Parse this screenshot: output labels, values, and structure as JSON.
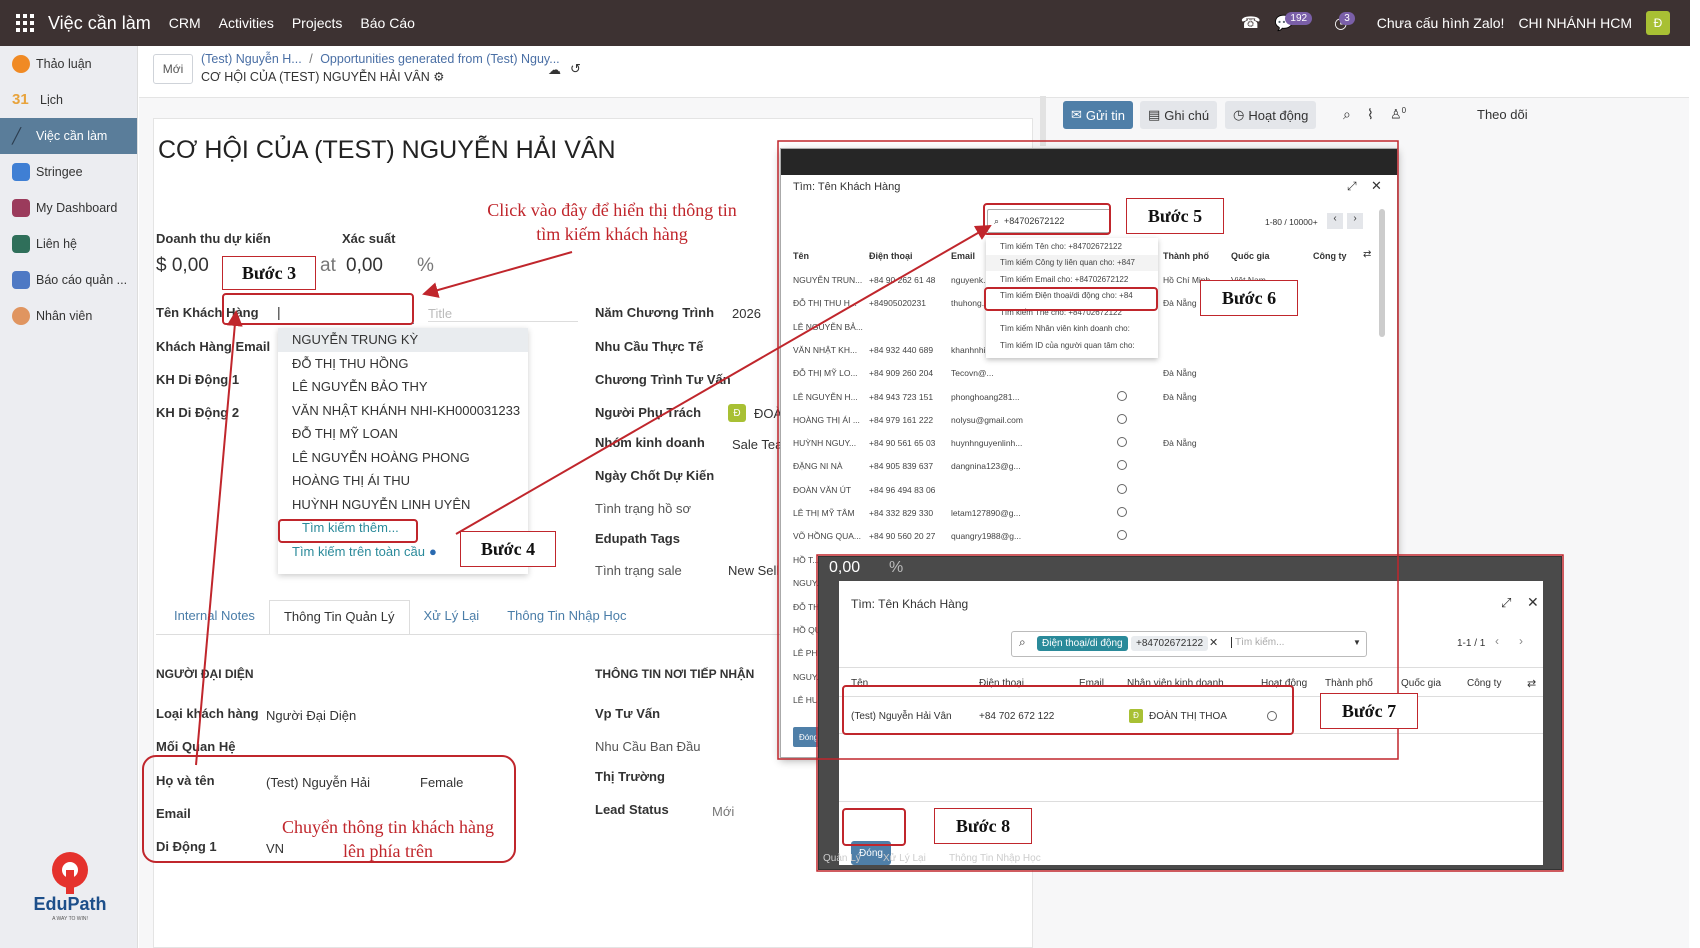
{
  "topbar": {
    "app_title": "Việc cần làm",
    "menus": [
      "CRM",
      "Activities",
      "Projects",
      "Báo Cáo"
    ],
    "badge_messages": "192",
    "badge_activities": "3",
    "zalo_status": "Chưa cấu hình Zalo!",
    "branch": "CHI NHÁNH HCM",
    "avatar_letter": "Đ"
  },
  "sidebar": {
    "items": [
      {
        "label": "Thảo luận",
        "icon": "discuss-icon"
      },
      {
        "label": "Lịch",
        "icon": "calendar-icon"
      },
      {
        "label": "Việc cần làm",
        "icon": "todo-icon"
      },
      {
        "label": "Stringee",
        "icon": "stringee-icon"
      },
      {
        "label": "My Dashboard",
        "icon": "dashboard-icon"
      },
      {
        "label": "Liên hệ",
        "icon": "contacts-icon"
      },
      {
        "label": "Báo cáo quản ...",
        "icon": "report-icon"
      },
      {
        "label": "Nhân viên",
        "icon": "employees-icon"
      }
    ],
    "logo_text": "EduPath",
    "logo_tagline": "A WAY TO WIN!"
  },
  "control": {
    "new_button": "Mới",
    "breadcrumb_1": "(Test) Nguyễn H...",
    "breadcrumb_sep": "/",
    "breadcrumb_2": "Opportunities generated from (Test) Nguy...",
    "record_title": "CƠ HỘI CỦA (TEST) NGUYỄN HẢI VÂN"
  },
  "form": {
    "title": "CƠ HỘI CỦA (TEST) NGUYỄN HẢI VÂN",
    "expected_revenue_label": "Doanh thu dự kiến",
    "expected_revenue": "$ 0,00",
    "probability_label": "Xác suất",
    "at_label": "at",
    "probability": "0,00",
    "percent": "%",
    "customer_name_label": "Tên Khách Hàng",
    "title_placeholder": "Title",
    "customer_email_label": "Khách Hàng Email",
    "mobile1_label": "KH Di Động 1",
    "mobile2_label": "KH Di Động 2",
    "program_year_label": "Năm Chương Trình",
    "program_year": "2026",
    "need_label": "Nhu Cầu Thực Tế",
    "program_label": "Chương Trình Tư Vấn",
    "owner_label": "Người Phụ Trách",
    "owner_value": "ĐOÀ",
    "team_label": "Nhóm kinh doanh",
    "team_value": "Sale Tea",
    "close_date_label": "Ngày Chốt Dự Kiến",
    "profile_status_label": "Tình trạng hồ sơ",
    "tags_label": "Edupath Tags",
    "sale_status_label": "Tình trạng sale",
    "sale_status_value": "New Sell",
    "tabs": [
      "Internal Notes",
      "Thông Tin Quản Lý",
      "Xử Lý Lại",
      "Thông Tin Nhập Học"
    ],
    "rep_section": "NGƯỜI ĐẠI DIỆN",
    "customer_type_label": "Loại khách hàng",
    "customer_type_value": "Người Đại Diện",
    "relation_label": "Mối Quan Hệ",
    "fullname_label": "Họ và tên",
    "fullname_value": "(Test) Nguyễn Hải",
    "gender_value": "Female",
    "email_label": "Email",
    "mobile_label": "Di Động 1",
    "mobile_prefix": "VN",
    "receive_section": "THÔNG TIN NƠI TIẾP NHẬN",
    "office_label": "Vp Tư Vấn",
    "initial_need_label": "Nhu Cầu Ban Đầu",
    "market_label": "Thị Trường",
    "lead_status_label": "Lead Status",
    "lead_status_value": "Mới"
  },
  "dropdown": {
    "items": [
      "NGUYỄN TRUNG KỲ",
      "ĐỖ THỊ THU HỒNG",
      "LÊ NGUYỄN BẢO THY",
      "VĂN NHẬT KHÁNH NHI-KH000031233",
      "ĐỖ THỊ MỸ LOAN",
      "LÊ NGUYỄN HOÀNG PHONG",
      "HOÀNG THỊ ÁI THU",
      "HUỲNH NGUYỄN LINH UYÊN"
    ],
    "search_more": "Tìm kiếm thêm...",
    "search_global": "Tìm kiếm trên toàn cầu"
  },
  "chatter": {
    "send": "Gửi tin",
    "note": "Ghi chú",
    "activity": "Hoạt động",
    "attach_count": "0",
    "follow": "Theo dõi"
  },
  "dialog1": {
    "title": "Tìm: Tên Khách Hàng",
    "search_value": "+84702672122",
    "pager": "1-80 / 10000+",
    "columns": [
      "Tên",
      "Điện thoại",
      "Email",
      "Thành phố",
      "Quốc gia",
      "Công ty"
    ],
    "rows": [
      {
        "name": "NGUYỄN TRUN...",
        "phone": "+84 90 262 61 48",
        "email": "nguyenk...",
        "city": "Hồ Chí Minh",
        "country": "Việt Nam"
      },
      {
        "name": "ĐỖ THỊ THU H...",
        "phone": "+84905020231",
        "email": "thuhong...",
        "city": "Đà Nẵng",
        "country": ""
      },
      {
        "name": "LÊ NGUYỄN BẢ...",
        "phone": "",
        "email": "",
        "city": "",
        "country": ""
      },
      {
        "name": "VĂN NHẬT KH...",
        "phone": "+84 932 440 689",
        "email": "khanhnhi...",
        "city": "",
        "country": ""
      },
      {
        "name": "ĐỖ THỊ MỸ LO...",
        "phone": "+84 909 260 204",
        "email": "Tecovn@...",
        "city": "Đà Nẵng",
        "country": ""
      },
      {
        "name": "LÊ NGUYỄN H...",
        "phone": "+84 943 723 151",
        "email": "phonghoang281...",
        "city": "Đà Nẵng",
        "country": ""
      },
      {
        "name": "HOÀNG THỊ ÁI ...",
        "phone": "+84 979 161 222",
        "email": "nolysu@gmail.com",
        "city": "",
        "country": ""
      },
      {
        "name": "HUỲNH NGUY...",
        "phone": "+84 90 561 65 03",
        "email": "huynhnguyenlinh...",
        "city": "Đà Nẵng",
        "country": ""
      },
      {
        "name": "ĐẶNG NI NÀ",
        "phone": "+84 905 839 637",
        "email": "dangnina123@g...",
        "city": "",
        "country": ""
      },
      {
        "name": "ĐOÀN VĂN ÚT",
        "phone": "+84 96 494 83 06",
        "email": "",
        "city": "",
        "country": ""
      },
      {
        "name": "LÊ THỊ MỸ TÂM",
        "phone": "+84 332 829 330",
        "email": "letam127890@g...",
        "city": "",
        "country": ""
      },
      {
        "name": "VÕ HỒNG QUA...",
        "phone": "+84 90 560 20 27",
        "email": "quangry1988@g...",
        "city": "",
        "country": ""
      }
    ],
    "suggestions": [
      "Tìm kiếm Tên cho: +84702672122",
      "Tìm kiếm Công ty liên quan cho: +847",
      "Tìm kiếm Email cho: +84702672122",
      "Tìm kiếm Điện thoại/di động cho: +84",
      "Tìm kiếm Thẻ cho: +84702672122",
      "Tìm kiếm Nhân viên kinh doanh cho:",
      "Tìm kiếm ID của người quan tâm cho:"
    ],
    "cut_names": [
      "HỒ T...",
      "NGUY...",
      "ĐỖ TH...",
      "HỒ QU...",
      "LÊ PH...",
      "NGUY...",
      "LÊ HU..."
    ],
    "close_short": "Đóng"
  },
  "dialog2": {
    "title": "Tìm: Tên Khách Hàng",
    "facet_label": "Điện thoại/di động",
    "facet_value": "+84702672122",
    "search_placeholder": "Tìm kiếm...",
    "pager": "1-1 / 1",
    "columns": [
      "Tên",
      "Điện thoại",
      "Email",
      "Nhân viên kinh doanh",
      "Hoạt động",
      "Thành phố",
      "Quốc gia",
      "Công ty"
    ],
    "row": {
      "name": "(Test) Nguyễn Hải Vân",
      "phone": "+84 702 672 122",
      "salesperson": "ĐOÀN THỊ THOA",
      "sp_letter": "Đ"
    },
    "close": "Đóng",
    "behind_value": "0,00",
    "behind_percent": "%",
    "footer_tabs": [
      "Quản Lý",
      "Xử Lý Lại",
      "Thông Tin Nhập Học"
    ]
  },
  "annotations": {
    "step3": "Bước 3",
    "step4": "Bước 4",
    "step5": "Bước 5",
    "step6": "Bước 6",
    "step7": "Bước 7",
    "step8": "Bước 8",
    "note_click": "Click vào đây để hiển thị thông tin tìm kiếm khách hàng",
    "note_move": "Chuyển thông tin khách hàng lên phía trên"
  },
  "colors": {
    "topbar": "#3d3232",
    "annotation_red": "#c0262c",
    "primary": "#4f7fa8",
    "link": "#2a8a9a"
  }
}
